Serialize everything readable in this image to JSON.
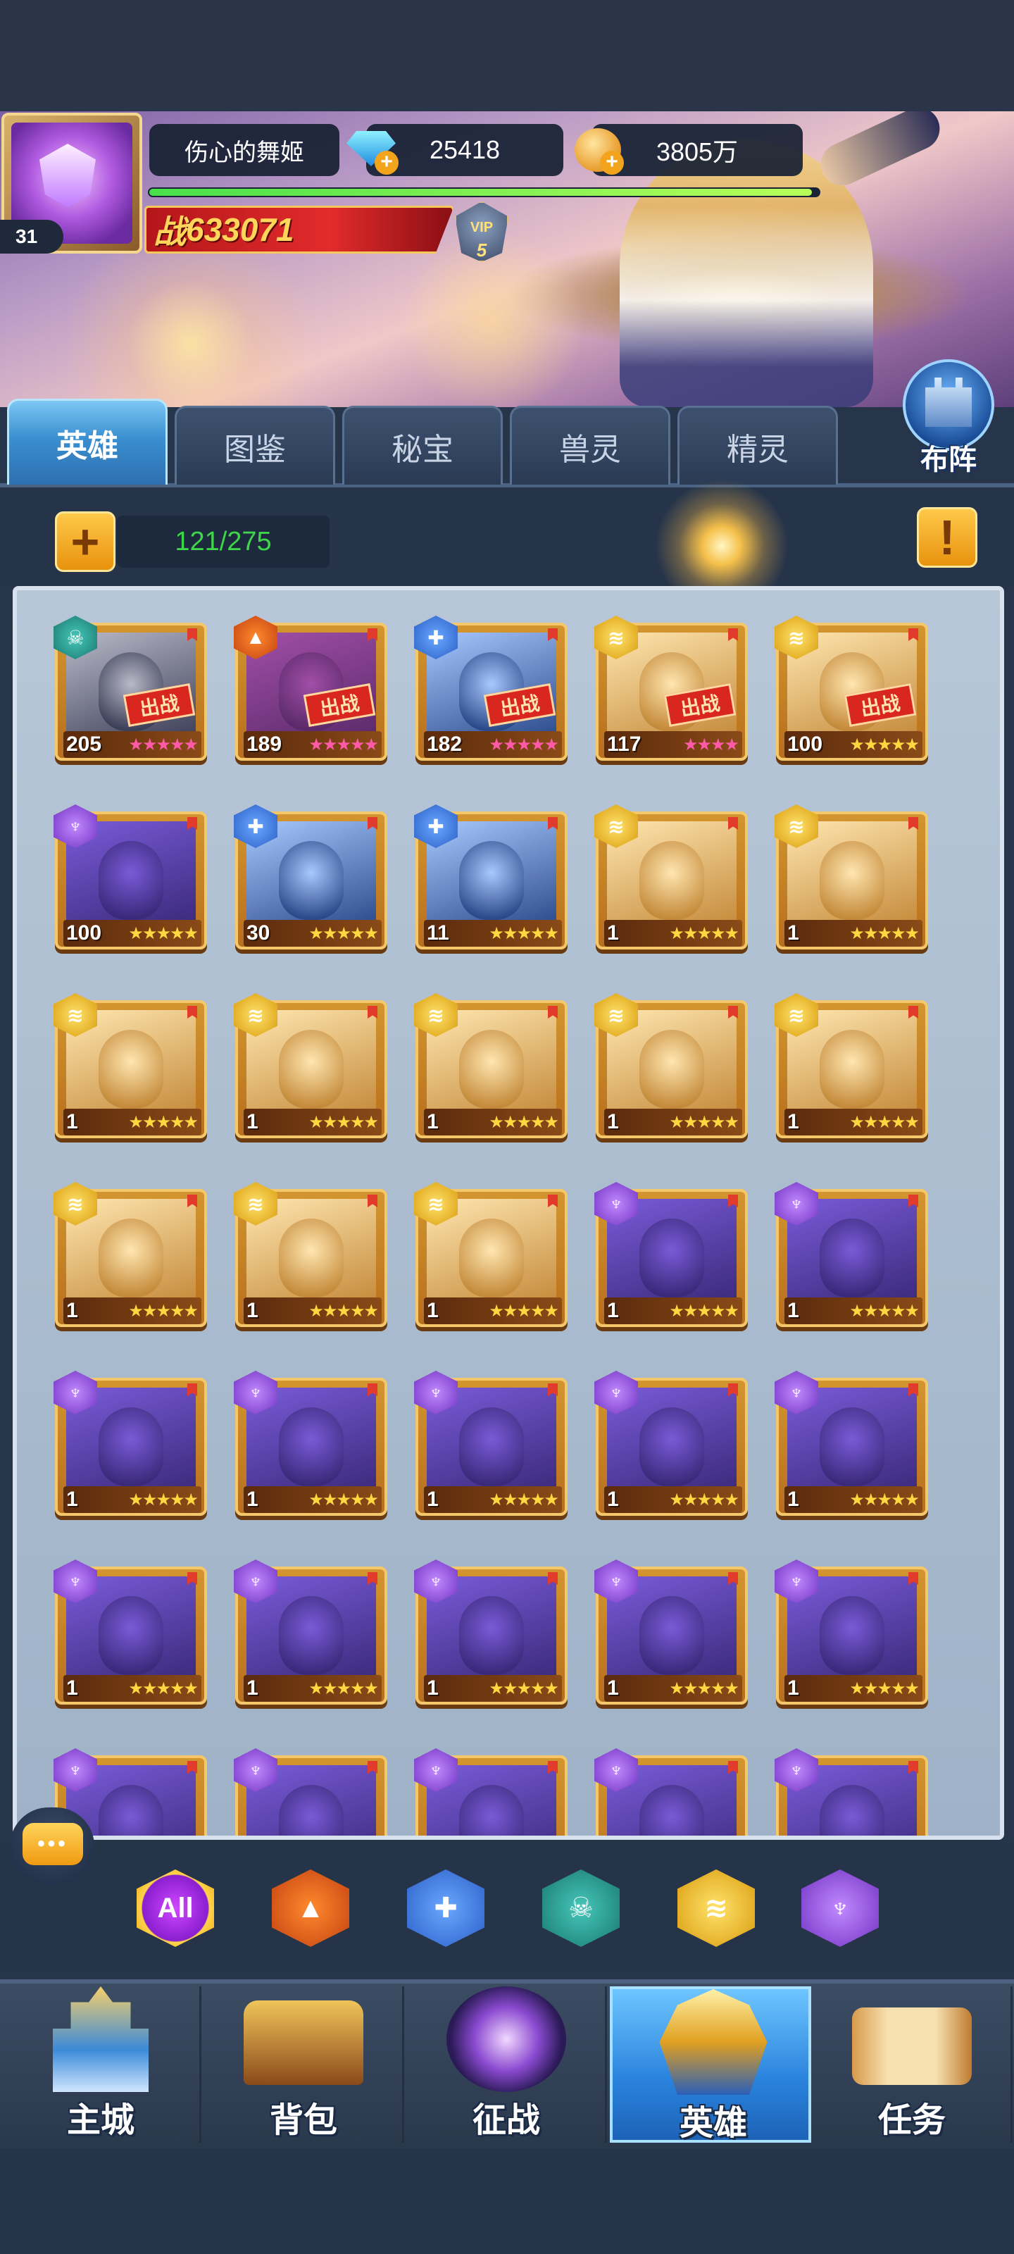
{
  "player": {
    "name": "伤心的舞姬",
    "level": "31",
    "diamonds": "25418",
    "gold": "3805万",
    "xp_progress": 0.99,
    "power_label": "战",
    "power_value": "633071",
    "vip_label": "VIP",
    "vip_level": "5"
  },
  "formation_button": {
    "label": "布阵",
    "icon": "castle-tower-icon"
  },
  "tabs": [
    {
      "label": "英雄",
      "active": true
    },
    {
      "label": "图鉴",
      "active": false
    },
    {
      "label": "秘宝",
      "active": false
    },
    {
      "label": "兽灵",
      "active": false
    },
    {
      "label": "精灵",
      "active": false
    }
  ],
  "roster": {
    "count": "121/275",
    "add_icon": "plus-icon",
    "info_icon": "exclamation-icon"
  },
  "deployed_label": "出战",
  "heroes": [
    {
      "level": "205",
      "faction": "dark",
      "stars": 5,
      "star_color": "pink",
      "deployed": true
    },
    {
      "level": "189",
      "faction": "fire",
      "stars": 5,
      "star_color": "pink",
      "deployed": true
    },
    {
      "level": "182",
      "faction": "water",
      "stars": 5,
      "star_color": "pink",
      "deployed": true
    },
    {
      "level": "117",
      "faction": "light",
      "stars": 4,
      "star_color": "pink",
      "deployed": true
    },
    {
      "level": "100",
      "faction": "light",
      "stars": 5,
      "star_color": "gold",
      "deployed": true
    },
    {
      "level": "100",
      "faction": "shadow",
      "stars": 5,
      "star_color": "gold",
      "deployed": false
    },
    {
      "level": "30",
      "faction": "water",
      "stars": 5,
      "star_color": "gold",
      "deployed": false
    },
    {
      "level": "11",
      "faction": "water",
      "stars": 5,
      "star_color": "gold",
      "deployed": false
    },
    {
      "level": "1",
      "faction": "light",
      "stars": 5,
      "star_color": "gold",
      "deployed": false
    },
    {
      "level": "1",
      "faction": "light",
      "stars": 5,
      "star_color": "gold",
      "deployed": false
    },
    {
      "level": "1",
      "faction": "light",
      "stars": 5,
      "star_color": "gold",
      "deployed": false
    },
    {
      "level": "1",
      "faction": "light",
      "stars": 5,
      "star_color": "gold",
      "deployed": false
    },
    {
      "level": "1",
      "faction": "light",
      "stars": 5,
      "star_color": "gold",
      "deployed": false
    },
    {
      "level": "1",
      "faction": "light",
      "stars": 5,
      "star_color": "gold",
      "deployed": false
    },
    {
      "level": "1",
      "faction": "light",
      "stars": 5,
      "star_color": "gold",
      "deployed": false
    },
    {
      "level": "1",
      "faction": "light",
      "stars": 5,
      "star_color": "gold",
      "deployed": false
    },
    {
      "level": "1",
      "faction": "light",
      "stars": 5,
      "star_color": "gold",
      "deployed": false
    },
    {
      "level": "1",
      "faction": "light",
      "stars": 5,
      "star_color": "gold",
      "deployed": false
    },
    {
      "level": "1",
      "faction": "shadow",
      "stars": 5,
      "star_color": "gold",
      "deployed": false
    },
    {
      "level": "1",
      "faction": "shadow",
      "stars": 5,
      "star_color": "gold",
      "deployed": false
    },
    {
      "level": "1",
      "faction": "shadow",
      "stars": 5,
      "star_color": "gold",
      "deployed": false
    },
    {
      "level": "1",
      "faction": "shadow",
      "stars": 5,
      "star_color": "gold",
      "deployed": false
    },
    {
      "level": "1",
      "faction": "shadow",
      "stars": 5,
      "star_color": "gold",
      "deployed": false
    },
    {
      "level": "1",
      "faction": "shadow",
      "stars": 5,
      "star_color": "gold",
      "deployed": false
    },
    {
      "level": "1",
      "faction": "shadow",
      "stars": 5,
      "star_color": "gold",
      "deployed": false
    },
    {
      "level": "1",
      "faction": "shadow",
      "stars": 5,
      "star_color": "gold",
      "deployed": false
    },
    {
      "level": "1",
      "faction": "shadow",
      "stars": 5,
      "star_color": "gold",
      "deployed": false
    },
    {
      "level": "1",
      "faction": "shadow",
      "stars": 5,
      "star_color": "gold",
      "deployed": false
    },
    {
      "level": "1",
      "faction": "shadow",
      "stars": 5,
      "star_color": "gold",
      "deployed": false
    },
    {
      "level": "1",
      "faction": "shadow",
      "stars": 5,
      "star_color": "gold",
      "deployed": false
    },
    {
      "level": "",
      "faction": "shadow",
      "stars": 0,
      "star_color": "gold",
      "deployed": false
    },
    {
      "level": "",
      "faction": "shadow",
      "stars": 0,
      "star_color": "gold",
      "deployed": false
    },
    {
      "level": "",
      "faction": "shadow",
      "stars": 0,
      "star_color": "gold",
      "deployed": false
    },
    {
      "level": "",
      "faction": "shadow",
      "stars": 0,
      "star_color": "gold",
      "deployed": false
    },
    {
      "level": "",
      "faction": "shadow",
      "stars": 0,
      "star_color": "gold",
      "deployed": false
    }
  ],
  "faction_filters": [
    {
      "label": "All",
      "icon": "all-factions-icon",
      "faction": "all"
    },
    {
      "label": "",
      "icon": "fire-faction-icon",
      "faction": "fire"
    },
    {
      "label": "",
      "icon": "water-faction-icon",
      "faction": "water"
    },
    {
      "label": "",
      "icon": "skull-faction-icon",
      "faction": "dark"
    },
    {
      "label": "",
      "icon": "wing-faction-icon",
      "faction": "light"
    },
    {
      "label": "",
      "icon": "horned-faction-icon",
      "faction": "shadow"
    }
  ],
  "chat": {
    "icon": "chat-bubble-icon",
    "glyph": "•••"
  },
  "bottom_nav": [
    {
      "label": "主城",
      "icon": "castle-icon",
      "active": false
    },
    {
      "label": "背包",
      "icon": "treasure-chest-icon",
      "active": false
    },
    {
      "label": "征战",
      "icon": "portal-dragon-icon",
      "active": false
    },
    {
      "label": "英雄",
      "icon": "helmet-icon",
      "active": true
    },
    {
      "label": "任务",
      "icon": "scroll-icon",
      "active": false
    }
  ],
  "colors": {
    "background": "#27354a",
    "accent_blue": "#3a8fd0",
    "gold": "#ffd740",
    "power_red": "#e22b2b",
    "count_green": "#3fd54a"
  }
}
